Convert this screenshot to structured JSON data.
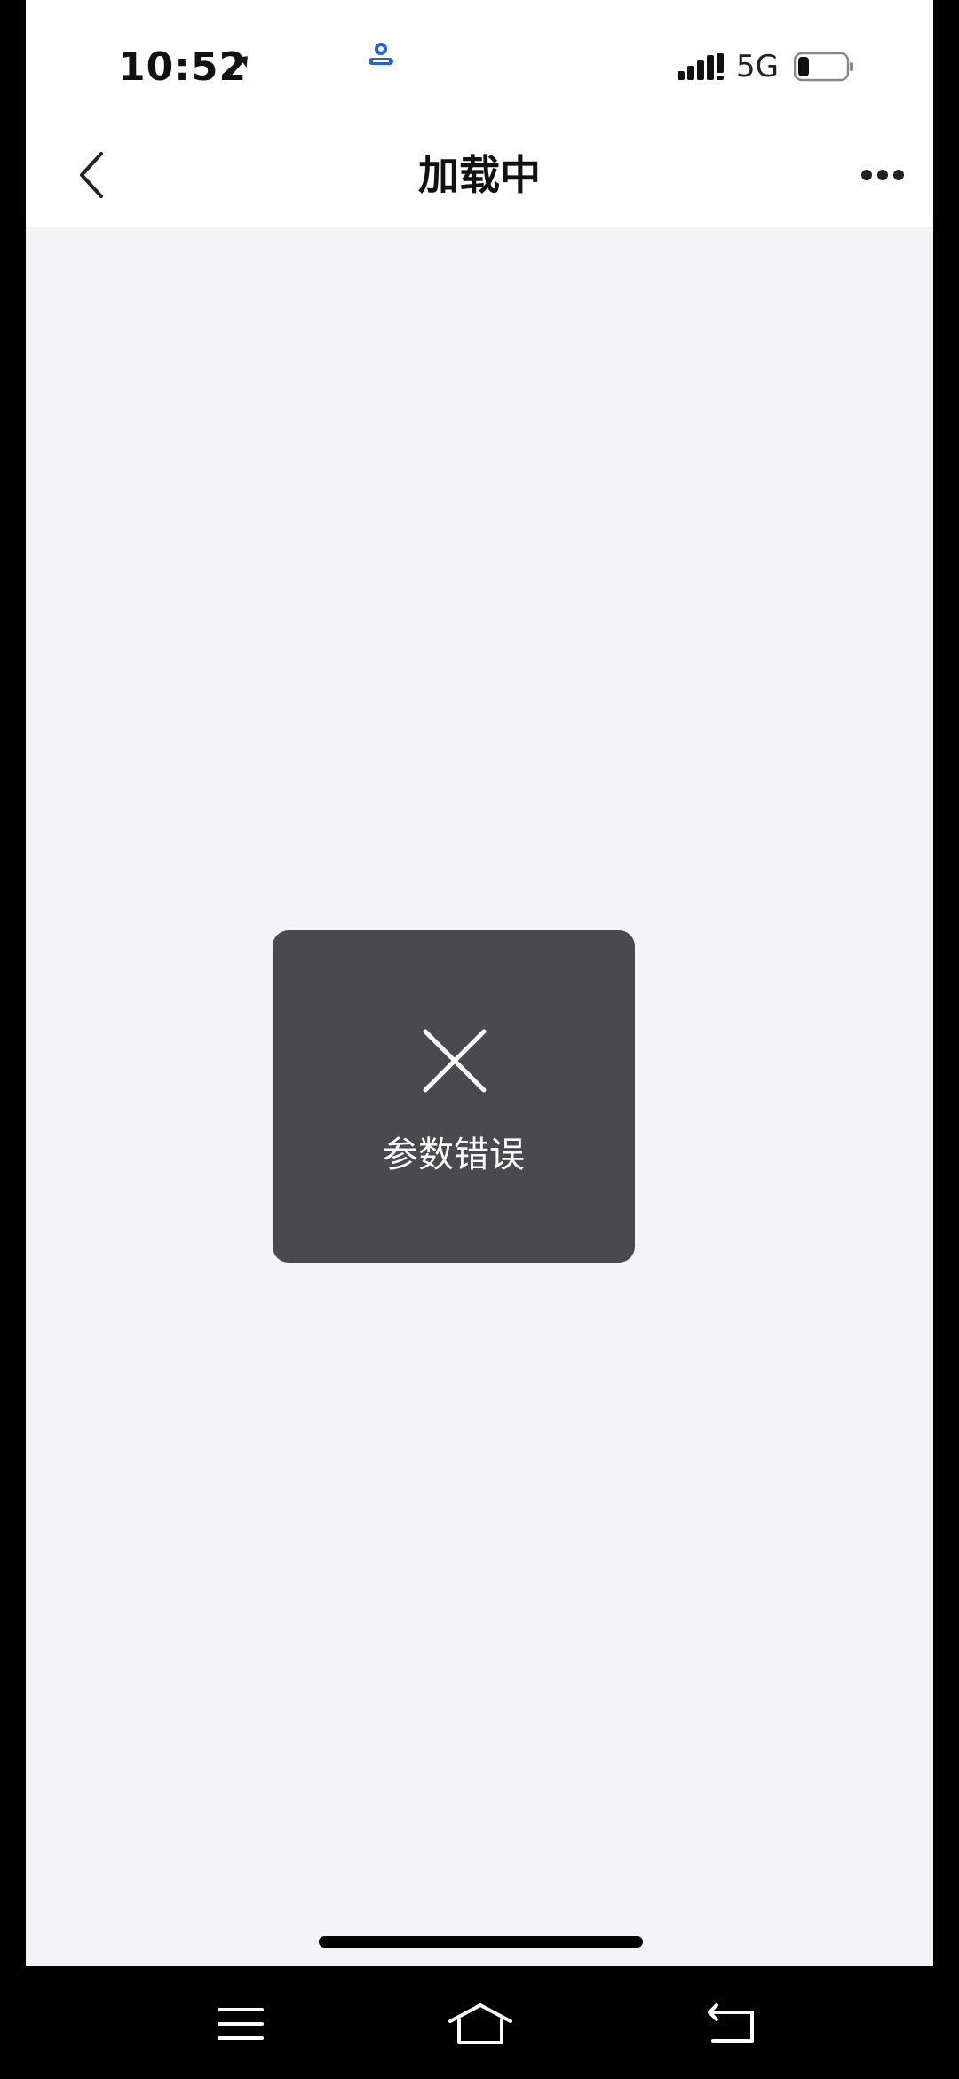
{
  "status_bar": {
    "time": "10:52",
    "time_suffix_icon": "location-arrow-icon",
    "notification_icon": "app-notification-icon",
    "signal_icon": "signal-bars-icon",
    "network": "5G",
    "battery_icon": "battery-icon"
  },
  "nav": {
    "back_icon": "chevron-left-icon",
    "title": "加载中",
    "more_icon": "more-dots-icon"
  },
  "toast": {
    "icon": "close-x-icon",
    "message": "参数错误"
  },
  "system_nav": {
    "menu_icon": "menu-icon",
    "home_icon": "home-icon",
    "back_icon": "back-icon"
  },
  "colors": {
    "page_background": "#f4f4f6",
    "header_background": "#ffffff",
    "toast_background": "#4a4a4c",
    "system_bar": "#000000",
    "notification_accent": "#2b5fd9"
  }
}
